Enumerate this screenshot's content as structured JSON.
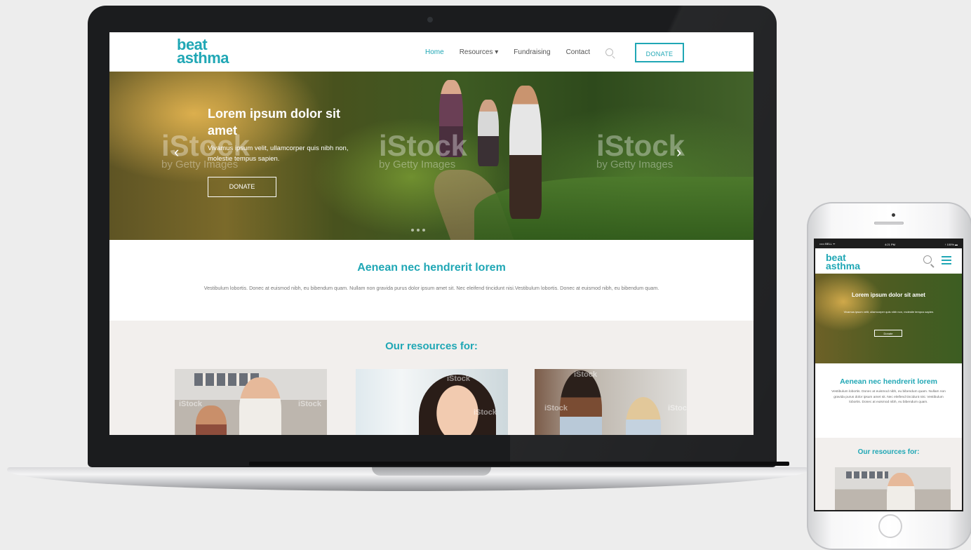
{
  "laptop_site": {
    "logo": [
      "beat",
      "asthma"
    ],
    "nav": {
      "home": "Home",
      "resources": "Resources ▾",
      "fundraising": "Fundraising",
      "contact": "Contact",
      "donate": "DONATE"
    },
    "hero": {
      "title": "Lorem ipsum dolor sit amet",
      "text": "Vivamus ipsum velit, ullamcorper quis nibh non, molestie tempus sapien.",
      "button": "DONATE",
      "prev_icon": "chevron-left-icon",
      "next_icon": "chevron-right-icon"
    },
    "watermark": {
      "brand": "iStock",
      "sub": "by Getty Images"
    },
    "intro": {
      "heading": "Aenean nec hendrerit lorem",
      "body": "Vestibulum lobortis. Donec at euismod nibh, eu bibendum quam. Nullam non gravida purus dolor ipsum amet sit. Nec eleifend tincidunt nisi.Vestibulum lobortis. Donec at euismod nibh, eu bibendum quam."
    },
    "resources": {
      "heading": "Our resources for:",
      "card_watermark": "iStock"
    }
  },
  "phone_site": {
    "status": {
      "carrier": "••••• BELL ᯤ",
      "time": "4:21 PM",
      "battery": "↑ 100% ▬"
    },
    "logo": [
      "beat",
      "asthma"
    ],
    "hero": {
      "title": "Lorem ipsum dolor sit amet",
      "text": "Vivamus ipsum velit, ullamcorper quis nibh non, molestie tempus sapien.",
      "button": "Donate"
    },
    "intro": {
      "heading": "Aenean nec hendrerit lorem",
      "body": "Vestibulum lobortis. Donec at euismod nibh, eu bibendum quam. Nullam non gravida purus dolor ipsum amet sit. Nec eleifend tincidunt nisi. Vestibulum lobortis. Donec at euismod nibh, eu bibendum quam."
    },
    "resources": {
      "heading": "Our resources for:"
    }
  },
  "colors": {
    "brand": "#20a7b5",
    "section_bg": "#f2efed"
  }
}
